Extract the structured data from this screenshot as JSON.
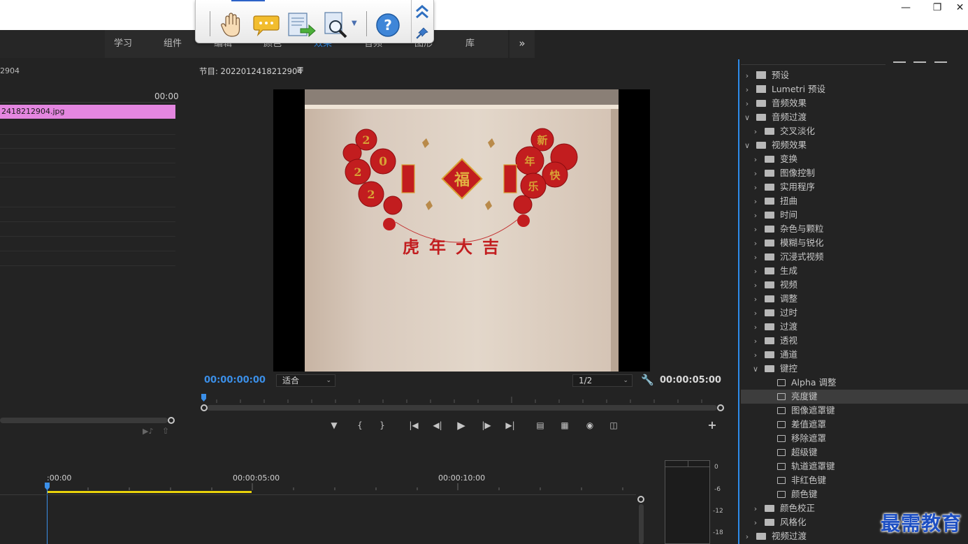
{
  "workspace_tabs": [
    "学习",
    "组件",
    "编辑",
    "颜色",
    "效果",
    "音频",
    "图形",
    "库"
  ],
  "left_panel": {
    "name_partial": "2904",
    "timecode": "00:00",
    "clip_name": "2418212904.jpg"
  },
  "program": {
    "title": "节目: 2022012418212904",
    "timecode_current": "00:00:00:00",
    "zoom": "适合",
    "resolution": "1/2",
    "duration": "00:00:05:00",
    "photo_text": "虎年大吉"
  },
  "timeline": {
    "ruler_labels": [
      ":00:00",
      "00:00:05:00",
      "00:00:10:00"
    ]
  },
  "meter": {
    "labels": [
      "0",
      "-6",
      "-12",
      "-18"
    ]
  },
  "effects_tree": [
    {
      "label": "预设",
      "level": 0,
      "icon": "preset-icon",
      "expanded": false
    },
    {
      "label": "Lumetri 预设",
      "level": 0,
      "icon": "preset-icon",
      "expanded": false
    },
    {
      "label": "音频效果",
      "level": 0,
      "icon": "folder-icon",
      "expanded": false
    },
    {
      "label": "音频过渡",
      "level": 0,
      "icon": "folder-icon",
      "expanded": true
    },
    {
      "label": "交叉淡化",
      "level": 1,
      "icon": "folder-icon",
      "expanded": false
    },
    {
      "label": "视频效果",
      "level": 0,
      "icon": "folder-icon",
      "expanded": true
    },
    {
      "label": "变换",
      "level": 1,
      "icon": "folder-icon",
      "expanded": false
    },
    {
      "label": "图像控制",
      "level": 1,
      "icon": "folder-icon",
      "expanded": false
    },
    {
      "label": "实用程序",
      "level": 1,
      "icon": "folder-icon",
      "expanded": false
    },
    {
      "label": "扭曲",
      "level": 1,
      "icon": "folder-icon",
      "expanded": false
    },
    {
      "label": "时间",
      "level": 1,
      "icon": "folder-icon",
      "expanded": false
    },
    {
      "label": "杂色与颗粒",
      "level": 1,
      "icon": "folder-icon",
      "expanded": false
    },
    {
      "label": "模糊与锐化",
      "level": 1,
      "icon": "folder-icon",
      "expanded": false
    },
    {
      "label": "沉浸式视频",
      "level": 1,
      "icon": "folder-icon",
      "expanded": false
    },
    {
      "label": "生成",
      "level": 1,
      "icon": "folder-icon",
      "expanded": false
    },
    {
      "label": "视频",
      "level": 1,
      "icon": "folder-icon",
      "expanded": false
    },
    {
      "label": "调整",
      "level": 1,
      "icon": "folder-icon",
      "expanded": false
    },
    {
      "label": "过时",
      "level": 1,
      "icon": "folder-icon",
      "expanded": false
    },
    {
      "label": "过渡",
      "level": 1,
      "icon": "folder-icon",
      "expanded": false
    },
    {
      "label": "透视",
      "level": 1,
      "icon": "folder-icon",
      "expanded": false
    },
    {
      "label": "通道",
      "level": 1,
      "icon": "folder-icon",
      "expanded": false
    },
    {
      "label": "键控",
      "level": 1,
      "icon": "folder-icon",
      "expanded": true
    },
    {
      "label": "Alpha 调整",
      "level": 2,
      "icon": "effect-icon",
      "expanded": null
    },
    {
      "label": "亮度键",
      "level": 2,
      "icon": "effect-icon",
      "expanded": null,
      "selected": true
    },
    {
      "label": "图像遮罩键",
      "level": 2,
      "icon": "effect-icon",
      "expanded": null
    },
    {
      "label": "差值遮罩",
      "level": 2,
      "icon": "effect-icon",
      "expanded": null
    },
    {
      "label": "移除遮罩",
      "level": 2,
      "icon": "effect-icon",
      "expanded": null
    },
    {
      "label": "超级键",
      "level": 2,
      "icon": "effect-icon",
      "expanded": null
    },
    {
      "label": "轨道遮罩键",
      "level": 2,
      "icon": "effect-icon",
      "expanded": null
    },
    {
      "label": "非红色键",
      "level": 2,
      "icon": "effect-icon",
      "expanded": null
    },
    {
      "label": "颜色键",
      "level": 2,
      "icon": "effect-icon",
      "expanded": null
    },
    {
      "label": "颜色校正",
      "level": 1,
      "icon": "folder-icon",
      "expanded": false
    },
    {
      "label": "风格化",
      "level": 1,
      "icon": "folder-icon",
      "expanded": false
    },
    {
      "label": "视频过渡",
      "level": 0,
      "icon": "folder-icon",
      "expanded": false
    }
  ],
  "watermark": "最需教育",
  "colors": {
    "accent": "#2d8ceb",
    "timecode_blue": "#3b8fe8",
    "clip_pink": "#e486e0",
    "workarea_yellow": "#e8d20a"
  }
}
